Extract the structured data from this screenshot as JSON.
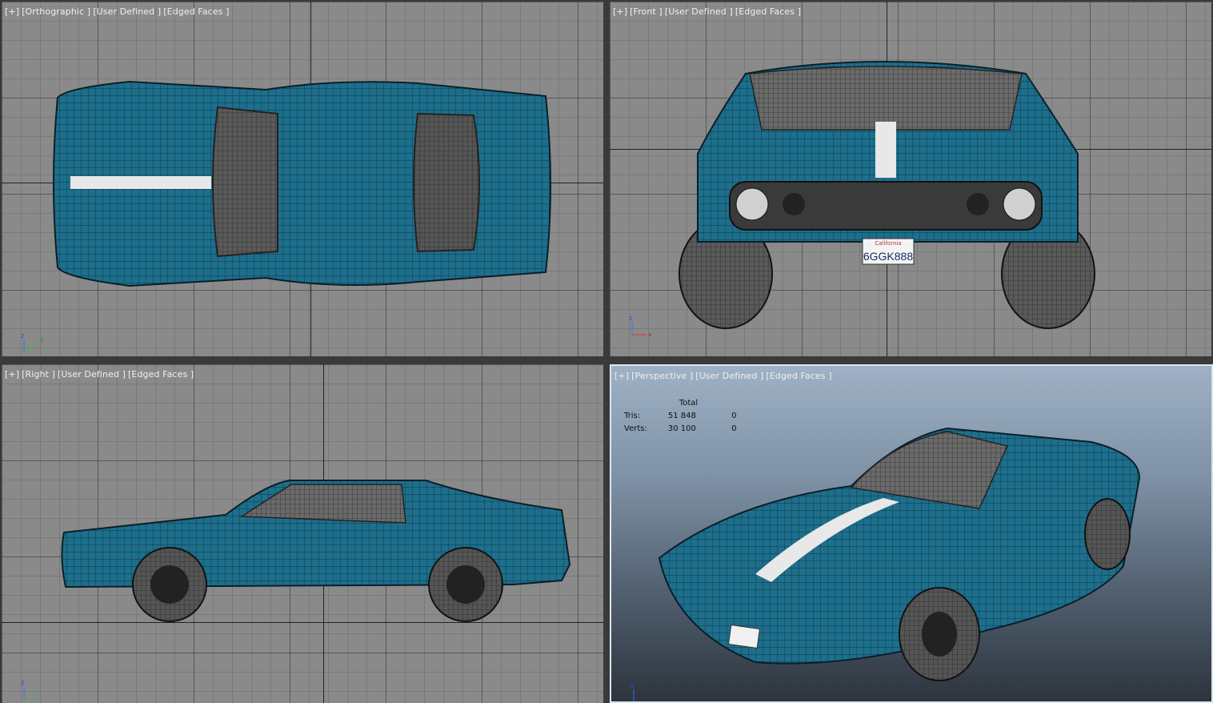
{
  "viewports": [
    {
      "id": "top",
      "labels": [
        "[+]",
        "[Orthographic ]",
        "[User Defined ]",
        "[Edged Faces ]"
      ]
    },
    {
      "id": "front",
      "labels": [
        "[+]",
        "[Front ]",
        "[User Defined ]",
        "[Edged Faces ]"
      ]
    },
    {
      "id": "right",
      "labels": [
        "[+]",
        "[Right ]",
        "[User Defined ]",
        "[Edged Faces ]"
      ]
    },
    {
      "id": "perspective",
      "labels": [
        "[+]",
        "[Perspective ]",
        "[User Defined ]",
        "[Edged Faces ]"
      ]
    }
  ],
  "stats": {
    "header": "Total",
    "rows": [
      {
        "label": "Tris:",
        "total": "51 848",
        "sel": "0"
      },
      {
        "label": "Verts:",
        "total": "30 100",
        "sel": "0"
      }
    ]
  },
  "license_plate": "6GGK888",
  "license_state": "California",
  "colors": {
    "body": "#1d6f8c",
    "stripe": "#e8e8e8",
    "grid": "#8a8a8a",
    "wire": "#0c2530"
  }
}
